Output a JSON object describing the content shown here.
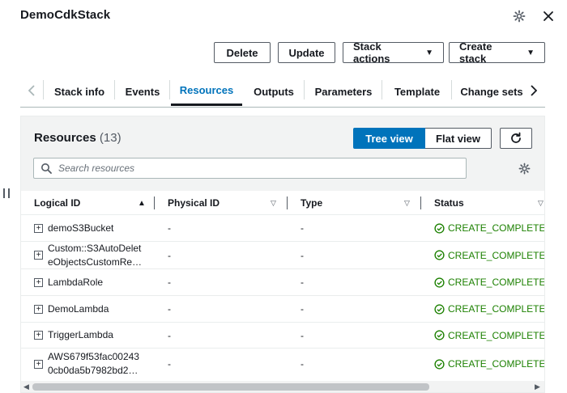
{
  "panel": {
    "title": "DemoCdkStack"
  },
  "actions": {
    "delete": "Delete",
    "update": "Update",
    "stack_actions": "Stack actions",
    "create_stack": "Create stack"
  },
  "tabs": [
    "Stack info",
    "Events",
    "Resources",
    "Outputs",
    "Parameters",
    "Template",
    "Change sets"
  ],
  "active_tab": "Resources",
  "resources": {
    "title": "Resources",
    "count": "(13)",
    "tree_view": "Tree view",
    "flat_view": "Flat view",
    "search_placeholder": "Search resources"
  },
  "table": {
    "columns": [
      "Logical ID",
      "Physical ID",
      "Type",
      "Status"
    ],
    "rows": [
      {
        "logical_id": "demoS3Bucket",
        "physical_id": "-",
        "type": "-",
        "status": "CREATE_COMPLETE"
      },
      {
        "logical_id_line1": "Custom::S3AutoDelet",
        "logical_id_line2": "eObjectsCustomRe…",
        "physical_id": "-",
        "type": "-",
        "status": "CREATE_COMPLETE"
      },
      {
        "logical_id": "LambdaRole",
        "physical_id": "-",
        "type": "-",
        "status": "CREATE_COMPLETE"
      },
      {
        "logical_id": "DemoLambda",
        "physical_id": "-",
        "type": "-",
        "status": "CREATE_COMPLETE"
      },
      {
        "logical_id": "TriggerLambda",
        "physical_id": "-",
        "type": "-",
        "status": "CREATE_COMPLETE"
      },
      {
        "logical_id_line1": "AWS679f53fac00243",
        "logical_id_line2": "0cb0da5b7982bd2…",
        "physical_id": "-",
        "type": "-",
        "status": "CREATE_COMPLETE"
      }
    ]
  },
  "colors": {
    "accent": "#0073bb",
    "success": "#1d8102",
    "text": "#16191f"
  },
  "icons": [
    "settings-icon",
    "close-icon",
    "chevron-left-icon",
    "chevron-right-icon",
    "refresh-icon",
    "search-icon",
    "sort-ascending-icon",
    "sort-icon",
    "expand-icon",
    "success-icon",
    "drag-handle-icon"
  ]
}
